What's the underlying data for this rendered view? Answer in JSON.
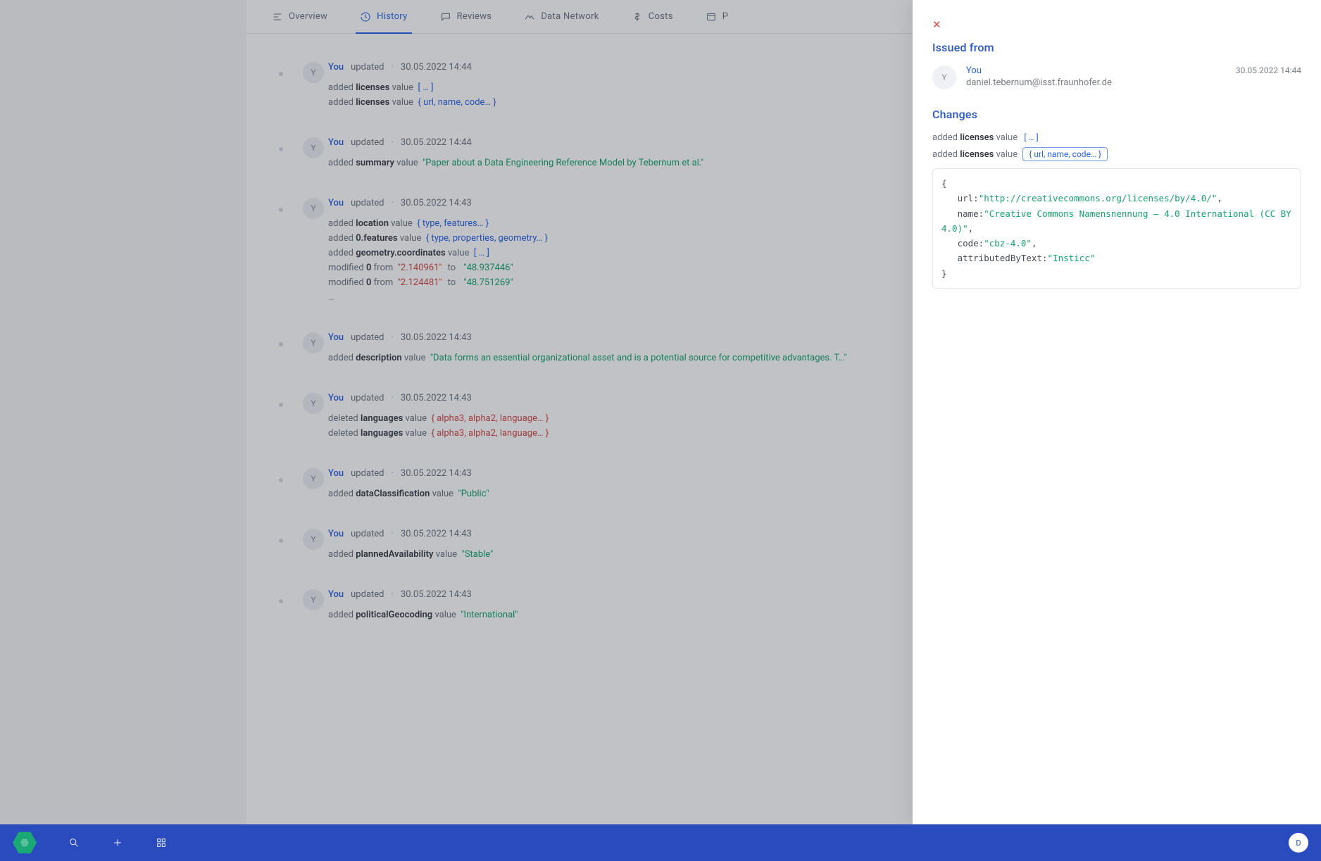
{
  "tabs": {
    "overview": "Overview",
    "history": "History",
    "reviews": "Reviews",
    "dataNetwork": "Data Network",
    "costs": "Costs",
    "lastCut": "P"
  },
  "common": {
    "you": "You",
    "updated": "updated",
    "sep": "·",
    "avatarLetter": "Y"
  },
  "history": [
    {
      "ts": "30.05.2022 14:44",
      "changes": [
        {
          "action": "added",
          "field": "licenses",
          "tail": "value",
          "obj": "[ … ]"
        },
        {
          "action": "added",
          "field": "licenses",
          "tail": "value",
          "obj": "{ url, name, code… }"
        }
      ]
    },
    {
      "ts": "30.05.2022 14:44",
      "changes": [
        {
          "action": "added",
          "field": "summary",
          "tail": "value",
          "str": "\"Paper about a Data Engineering Reference Model by Tebernum et al.\""
        }
      ]
    },
    {
      "ts": "30.05.2022 14:43",
      "changes": [
        {
          "action": "added",
          "field": "location",
          "tail": "value",
          "obj": "{ type, features… }"
        },
        {
          "action": "added",
          "field": "0.features",
          "tail": "value",
          "obj": "{ type, properties, geometry… }"
        },
        {
          "action": "added",
          "field": "geometry.coordinates",
          "tail": "value",
          "obj": "[ … ]"
        },
        {
          "action": "modified",
          "field": "0",
          "tail": "from",
          "strRed": "\"2.140961\"",
          "mid": "to",
          "str": "\"48.937446\""
        },
        {
          "action": "modified",
          "field": "0",
          "tail": "from",
          "strRed": "\"2.124481\"",
          "mid": "to",
          "str": "\"48.751269\""
        },
        {
          "ellipsis": "…"
        }
      ]
    },
    {
      "ts": "30.05.2022 14:43",
      "changes": [
        {
          "action": "added",
          "field": "description",
          "tail": "value",
          "str": "\"Data forms an essential organizational asset and is a potential source for competitive advantages. T…\""
        }
      ]
    },
    {
      "ts": "30.05.2022 14:43",
      "changes": [
        {
          "action": "deleted",
          "field": "languages",
          "tail": "value",
          "objRed": "{ alpha3, alpha2, language… }"
        },
        {
          "action": "deleted",
          "field": "languages",
          "tail": "value",
          "objRed": "{ alpha3, alpha2, language… }"
        }
      ]
    },
    {
      "ts": "30.05.2022 14:43",
      "changes": [
        {
          "action": "added",
          "field": "dataClassification",
          "tail": "value",
          "str": "\"Public\""
        }
      ]
    },
    {
      "ts": "30.05.2022 14:43",
      "changes": [
        {
          "action": "added",
          "field": "plannedAvailability",
          "tail": "value",
          "str": "\"Stable\""
        }
      ]
    },
    {
      "ts": "30.05.2022 14:43",
      "changes": [
        {
          "action": "added",
          "field": "politicalGeocoding",
          "tail": "value",
          "str": "\"International\""
        }
      ]
    }
  ],
  "panel": {
    "issuedFrom": "Issued from",
    "you": "You",
    "email": "daniel.tebernum@isst.fraunhofer.de",
    "ts": "30.05.2022 14:44",
    "changesHeading": "Changes",
    "line1": {
      "action": "added",
      "field": "licenses",
      "tail": "value",
      "pill": "[ … ]"
    },
    "line2": {
      "action": "added",
      "field": "licenses",
      "tail": "value",
      "pill": "{ url, name, code… }"
    },
    "code": {
      "url_k": "url:",
      "url_v": "\"http://creativecommons.org/licenses/by/4.0/\"",
      "name_k": "name:",
      "name_v": "\"Creative Commons Namensnennung – 4.0 International (CC BY 4.0)\"",
      "code_k": "code:",
      "code_v": "\"cbz-4.0\"",
      "attr_k": "attributedByText:",
      "attr_v": "\"Insticc\""
    }
  },
  "bottom": {
    "userLetter": "D"
  }
}
